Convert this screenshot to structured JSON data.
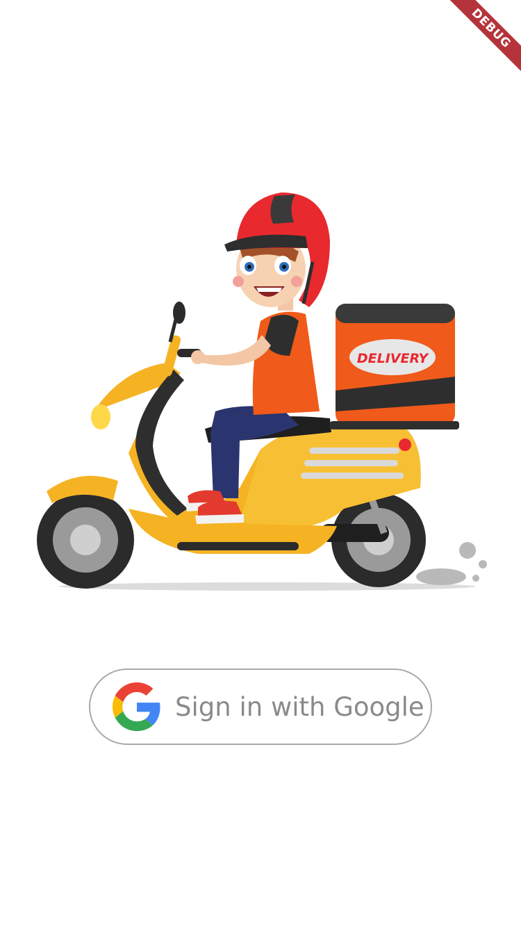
{
  "debug_banner": {
    "label": "DEBUG"
  },
  "illustration": {
    "box_label": "DELIVERY",
    "subject": "delivery-rider-on-scooter"
  },
  "signin": {
    "label": "Sign in with Google",
    "icon": "google-g-icon"
  },
  "colors": {
    "background": "#ffffff",
    "button_border": "#a9a9a9",
    "button_text": "#8a8a8a",
    "debug_ribbon": "#b5343c",
    "scooter_yellow": "#f5b324",
    "delivery_orange": "#f05a1a",
    "helmet_red": "#e8292e"
  }
}
